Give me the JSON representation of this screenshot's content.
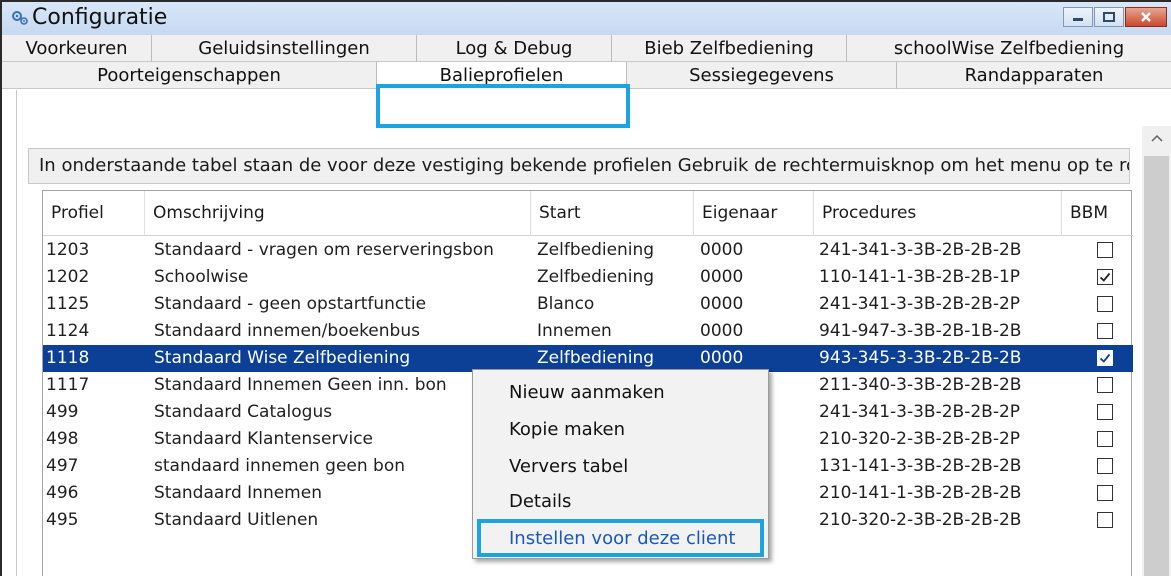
{
  "window": {
    "title": "Configuratie",
    "accent_color": "#1ba4e0",
    "selection_color": "#0c3f96"
  },
  "tabs_row1": [
    {
      "label": "Voorkeuren"
    },
    {
      "label": "Geluidsinstellingen"
    },
    {
      "label": "Log & Debug"
    },
    {
      "label": "Bieb Zelfbediening"
    },
    {
      "label": "schoolWise Zelfbediening"
    }
  ],
  "tabs_row2": [
    {
      "label": "Poorteigenschappen"
    },
    {
      "label": "Balieprofielen",
      "selected": true
    },
    {
      "label": "Sessiegegevens"
    },
    {
      "label": "Randapparaten"
    }
  ],
  "info_text": "In onderstaande tabel staan de voor deze vestiging bekende profielen Gebruik de rechtermuisknop om het menu op te roeper",
  "table": {
    "headers": [
      "Profiel",
      "Omschrijving",
      "Start",
      "Eigenaar",
      "Procedures",
      "BBM"
    ],
    "rows": [
      {
        "profiel": "1203",
        "omschrijving": "Standaard - vragen om reserveringsbon",
        "start": "Zelfbediening",
        "eigenaar": "0000",
        "procedures": "241-341-3-3B-2B-2B-2B",
        "bbm": false,
        "selected": false
      },
      {
        "profiel": "1202",
        "omschrijving": "Schoolwise",
        "start": "Zelfbediening",
        "eigenaar": "0000",
        "procedures": "110-141-1-3B-2B-2B-1P",
        "bbm": true,
        "selected": false
      },
      {
        "profiel": "1125",
        "omschrijving": "Standaard - geen opstartfunctie",
        "start": "Blanco",
        "eigenaar": "0000",
        "procedures": "241-341-3-3B-2B-2B-2P",
        "bbm": false,
        "selected": false
      },
      {
        "profiel": "1124",
        "omschrijving": "Standaard innemen/boekenbus",
        "start": "Innemen",
        "eigenaar": "0000",
        "procedures": "941-947-3-3B-2B-1B-2B",
        "bbm": false,
        "selected": false
      },
      {
        "profiel": "1118",
        "omschrijving": "Standaard Wise Zelfbediening",
        "start": "Zelfbediening",
        "eigenaar": "0000",
        "procedures": "943-345-3-3B-2B-2B-2B",
        "bbm": true,
        "selected": true
      },
      {
        "profiel": "1117",
        "omschrijving": "Standaard Innemen Geen inn. bon",
        "start": "",
        "eigenaar": "",
        "procedures": "211-340-3-3B-2B-2B-2B",
        "bbm": false,
        "selected": false
      },
      {
        "profiel": "499",
        "omschrijving": "Standaard Catalogus",
        "start": "",
        "eigenaar": "",
        "procedures": "241-341-3-3B-2B-2B-2P",
        "bbm": false,
        "selected": false
      },
      {
        "profiel": "498",
        "omschrijving": "Standaard Klantenservice",
        "start": "",
        "eigenaar": "",
        "procedures": "210-320-2-3B-2B-2B-2P",
        "bbm": false,
        "selected": false
      },
      {
        "profiel": "497",
        "omschrijving": "standaard innemen geen bon",
        "start": "",
        "eigenaar": "",
        "procedures": "131-141-3-3B-2B-2B-2B",
        "bbm": false,
        "selected": false
      },
      {
        "profiel": "496",
        "omschrijving": "Standaard Innemen",
        "start": "",
        "eigenaar": "",
        "procedures": "210-141-1-3B-2B-2B-2B",
        "bbm": false,
        "selected": false
      },
      {
        "profiel": "495",
        "omschrijving": "Standaard Uitlenen",
        "start": "",
        "eigenaar": "",
        "procedures": "210-320-2-3B-2B-2B-2B",
        "bbm": false,
        "selected": false
      }
    ]
  },
  "context_menu": {
    "items": [
      {
        "label": "Nieuw aanmaken"
      },
      {
        "label": "Kopie maken"
      },
      {
        "label": "Ververs tabel"
      },
      {
        "label": "Details"
      },
      {
        "label": "Instellen voor deze client",
        "highlighted": true
      }
    ]
  }
}
